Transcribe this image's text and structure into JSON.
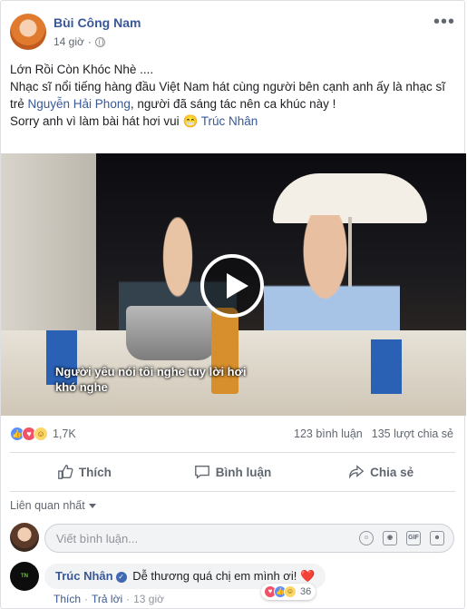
{
  "post": {
    "author": "Bùi Công Nam",
    "time": "14 giờ",
    "menu": "•••",
    "lines": {
      "l1": "Lớn Rồi Còn Khóc Nhè ....",
      "l2_a": "Nhạc sĩ nổi tiếng hàng đầu Việt Nam hát cùng người bên cạnh anh ấy là nhạc sĩ trẻ ",
      "l2_link": "Nguyễn Hải Phong",
      "l2_b": ", người đã sáng tác nên ca khúc này !",
      "l3_a": "Sorry anh vì làm bài hát hơi vui ",
      "l3_emoji": "😁",
      "l3_link": "Trúc Nhân"
    },
    "video": {
      "subtitle": "Người yêu nói tôi nghe tuy lời hơi khó nghe"
    }
  },
  "stats": {
    "reactions_count": "1,7K",
    "comments": "123 bình luận",
    "shares": "135 lượt chia sẻ"
  },
  "actions": {
    "like": "Thích",
    "comment": "Bình luận",
    "share": "Chia sẻ"
  },
  "comments": {
    "sort": "Liên quan nhất",
    "input_placeholder": "Viết bình luận...",
    "input_icons": [
      "emoji-icon",
      "camera-icon",
      "gif-icon",
      "sticker-icon"
    ],
    "items": [
      {
        "name": "Trúc Nhân",
        "text": "Dễ thương quá chị em mình ơi!",
        "heart": "❤️",
        "reaction_count": "36",
        "like": "Thích",
        "reply": "Trả lời",
        "time": "13 giờ"
      }
    ]
  },
  "colors": {
    "link": "#385898",
    "like": "#5890ff",
    "love": "#f25268",
    "haha": "#fcd667"
  }
}
